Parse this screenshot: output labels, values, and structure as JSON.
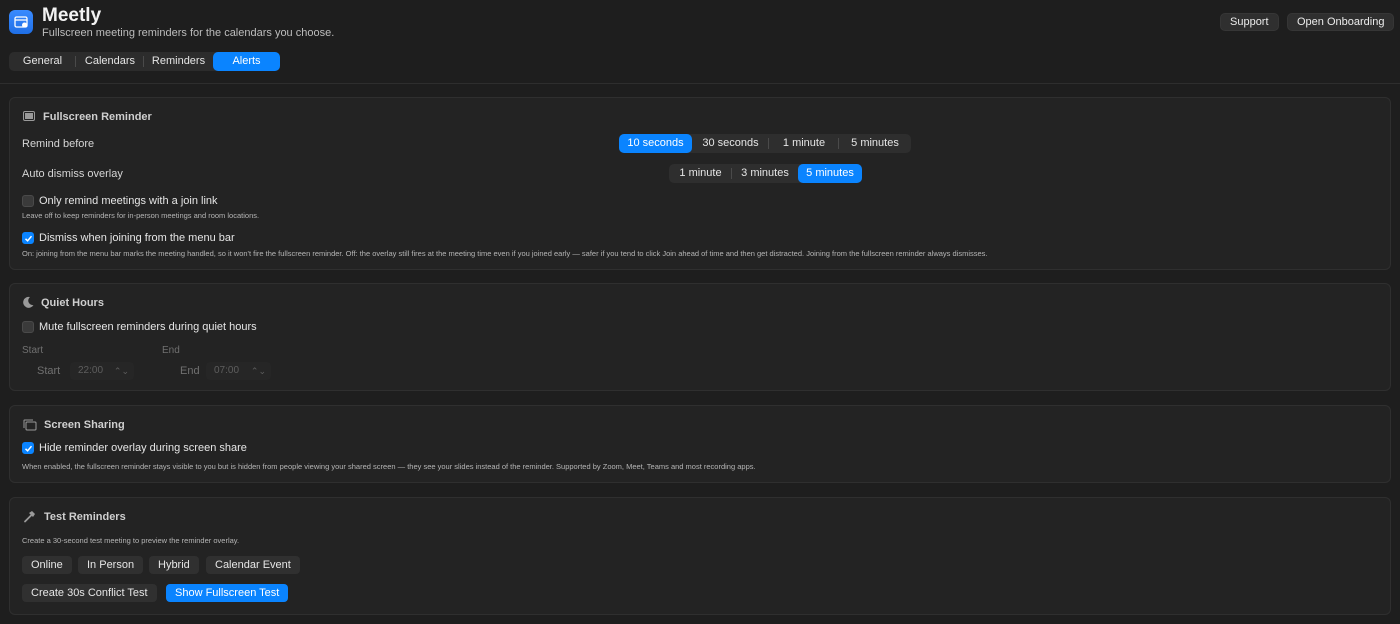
{
  "app": {
    "title": "Meetly",
    "subtitle": "Fullscreen meeting reminders for the calendars you choose.",
    "support_label": "Support",
    "onboarding_label": "Open Onboarding"
  },
  "tabs": [
    {
      "label": "General"
    },
    {
      "label": "Calendars"
    },
    {
      "label": "Reminders"
    },
    {
      "label": "Alerts",
      "active": true
    }
  ],
  "fullscreen": {
    "title": "Fullscreen Reminder",
    "remind_before_label": "Remind before",
    "remind_before_options": [
      "10 seconds",
      "30 seconds",
      "1 minute",
      "5 minutes"
    ],
    "remind_before_selected": "10 seconds",
    "auto_dismiss_label": "Auto dismiss overlay",
    "auto_dismiss_options": [
      "1 minute",
      "3 minutes",
      "5 minutes"
    ],
    "auto_dismiss_selected": "5 minutes",
    "join_link_label": "Only remind meetings with a join link",
    "join_link_checked": false,
    "join_link_help": "Leave off to keep reminders for in-person meetings and room locations.",
    "dismiss_menu_label": "Dismiss when joining from the menu bar",
    "dismiss_menu_checked": true,
    "dismiss_menu_help": "On: joining from the menu bar marks the meeting handled, so it won't fire the fullscreen reminder. Off: the overlay still fires at the meeting time even if you joined early — safer if you tend to click Join ahead of time and then get distracted. Joining from the fullscreen reminder always dismisses."
  },
  "quiet": {
    "title": "Quiet Hours",
    "mute_label": "Mute fullscreen reminders during quiet hours",
    "mute_checked": false,
    "start_header": "Start",
    "end_header": "End",
    "start_label": "Start",
    "start_value": "22:00",
    "end_label": "End",
    "end_value": "07:00"
  },
  "screen": {
    "title": "Screen Sharing",
    "hide_label": "Hide reminder overlay during screen share",
    "hide_checked": true,
    "hide_help": "When enabled, the fullscreen reminder stays visible to you but is hidden from people viewing your shared screen — they see your slides instead of the reminder. Supported by Zoom, Meet, Teams and most recording apps."
  },
  "test": {
    "title": "Test Reminders",
    "help": "Create a 30-second test meeting to preview the reminder overlay.",
    "online_label": "Online",
    "in_person_label": "In Person",
    "hybrid_label": "Hybrid",
    "calendar_event_label": "Calendar Event",
    "conflict_label": "Create 30s Conflict Test",
    "fullscreen_label": "Show Fullscreen Test"
  },
  "colors": {
    "accent": "#0a84ff",
    "background": "#1e1e1e",
    "card": "#232323"
  }
}
